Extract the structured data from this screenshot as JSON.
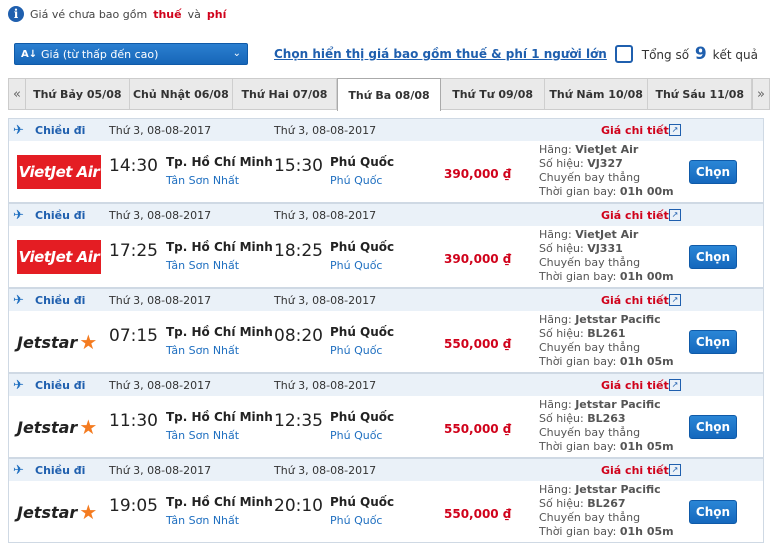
{
  "notice": {
    "text_before": "Giá vé chưa bao gồm",
    "tax": "thuế",
    "and": "và",
    "fee": "phí"
  },
  "sort": {
    "selected": "Giá (từ thấp đến cao)"
  },
  "tax_toggle_label": "Chọn hiển thị giá bao gồm thuế & phí 1 người lớn",
  "total": {
    "prefix": "Tổng số",
    "count": "9",
    "suffix": "kết quả"
  },
  "date_tabs": [
    {
      "label": "Thứ Bảy 05/08",
      "active": false
    },
    {
      "label": "Chủ Nhật 06/08",
      "active": false
    },
    {
      "label": "Thứ Hai 07/08",
      "active": false
    },
    {
      "label": "Thứ Ba 08/08",
      "active": true
    },
    {
      "label": "Thứ Tư 09/08",
      "active": false
    },
    {
      "label": "Thứ Năm 10/08",
      "active": false
    },
    {
      "label": "Thứ Sáu 11/08",
      "active": false
    }
  ],
  "icons": {
    "prev": "«",
    "next": "»",
    "plane": "✈",
    "external": "↗",
    "info": "i",
    "sort": "A↓",
    "chevron": "⌄"
  },
  "colors": {
    "accent": "#1f5fae",
    "price": "#d0021b",
    "vietjet": "#e41d23",
    "jetstar_star": "#f47b20"
  },
  "flights": [
    {
      "direction": "Chiều đi",
      "dep_date": "Thứ 3, 08-08-2017",
      "arr_date": "Thứ 3, 08-08-2017",
      "detail": "Giá chi tiết",
      "airline_logo": "VietJet Air",
      "logo_type": "vj",
      "dep_time": "14:30",
      "dep_city": "Tp. Hồ Chí Minh",
      "dep_airport": "Tân Sơn Nhất",
      "arr_time": "15:30",
      "arr_city": "Phú Quốc",
      "arr_airport": "Phú Quốc",
      "price": "390,000 ₫",
      "airline_label": "Hãng:",
      "airline": "VietJet Air",
      "flightno_label": "Số hiệu:",
      "flightno": "VJ327",
      "type": "Chuyến bay thẳng",
      "duration_label": "Thời gian bay:",
      "duration": "01h 00m",
      "button": "Chọn"
    },
    {
      "direction": "Chiều đi",
      "dep_date": "Thứ 3, 08-08-2017",
      "arr_date": "Thứ 3, 08-08-2017",
      "detail": "Giá chi tiết",
      "airline_logo": "VietJet Air",
      "logo_type": "vj",
      "dep_time": "17:25",
      "dep_city": "Tp. Hồ Chí Minh",
      "dep_airport": "Tân Sơn Nhất",
      "arr_time": "18:25",
      "arr_city": "Phú Quốc",
      "arr_airport": "Phú Quốc",
      "price": "390,000 ₫",
      "airline_label": "Hãng:",
      "airline": "VietJet Air",
      "flightno_label": "Số hiệu:",
      "flightno": "VJ331",
      "type": "Chuyến bay thẳng",
      "duration_label": "Thời gian bay:",
      "duration": "01h 00m",
      "button": "Chọn"
    },
    {
      "direction": "Chiều đi",
      "dep_date": "Thứ 3, 08-08-2017",
      "arr_date": "Thứ 3, 08-08-2017",
      "detail": "Giá chi tiết",
      "airline_logo": "Jetstar",
      "logo_type": "js",
      "dep_time": "07:15",
      "dep_city": "Tp. Hồ Chí Minh",
      "dep_airport": "Tân Sơn Nhất",
      "arr_time": "08:20",
      "arr_city": "Phú Quốc",
      "arr_airport": "Phú Quốc",
      "price": "550,000 ₫",
      "airline_label": "Hãng:",
      "airline": "Jetstar Pacific",
      "flightno_label": "Số hiệu:",
      "flightno": "BL261",
      "type": "Chuyến bay thẳng",
      "duration_label": "Thời gian bay:",
      "duration": "01h 05m",
      "button": "Chọn"
    },
    {
      "direction": "Chiều đi",
      "dep_date": "Thứ 3, 08-08-2017",
      "arr_date": "Thứ 3, 08-08-2017",
      "detail": "Giá chi tiết",
      "airline_logo": "Jetstar",
      "logo_type": "js",
      "dep_time": "11:30",
      "dep_city": "Tp. Hồ Chí Minh",
      "dep_airport": "Tân Sơn Nhất",
      "arr_time": "12:35",
      "arr_city": "Phú Quốc",
      "arr_airport": "Phú Quốc",
      "price": "550,000 ₫",
      "airline_label": "Hãng:",
      "airline": "Jetstar Pacific",
      "flightno_label": "Số hiệu:",
      "flightno": "BL263",
      "type": "Chuyến bay thẳng",
      "duration_label": "Thời gian bay:",
      "duration": "01h 05m",
      "button": "Chọn"
    },
    {
      "direction": "Chiều đi",
      "dep_date": "Thứ 3, 08-08-2017",
      "arr_date": "Thứ 3, 08-08-2017",
      "detail": "Giá chi tiết",
      "airline_logo": "Jetstar",
      "logo_type": "js",
      "dep_time": "19:05",
      "dep_city": "Tp. Hồ Chí Minh",
      "dep_airport": "Tân Sơn Nhất",
      "arr_time": "20:10",
      "arr_city": "Phú Quốc",
      "arr_airport": "Phú Quốc",
      "price": "550,000 ₫",
      "airline_label": "Hãng:",
      "airline": "Jetstar Pacific",
      "flightno_label": "Số hiệu:",
      "flightno": "BL267",
      "type": "Chuyến bay thẳng",
      "duration_label": "Thời gian bay:",
      "duration": "01h 05m",
      "button": "Chọn"
    }
  ]
}
